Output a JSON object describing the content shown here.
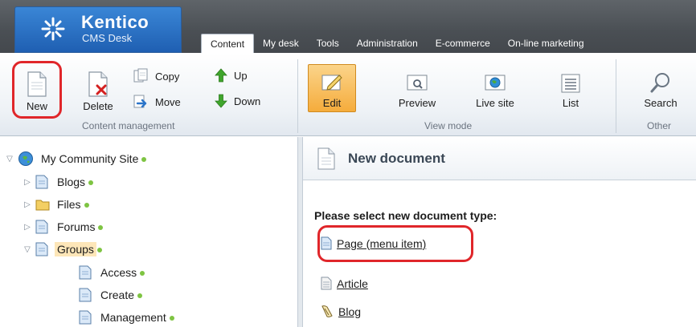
{
  "header": {
    "brand": "Kentico",
    "product": "CMS Desk",
    "tabs": [
      "Content",
      "My desk",
      "Tools",
      "Administration",
      "E-commerce",
      "On-line marketing"
    ],
    "active_tab": "Content"
  },
  "toolbar": {
    "new_label": "New",
    "delete_label": "Delete",
    "copy_label": "Copy",
    "move_label": "Move",
    "up_label": "Up",
    "down_label": "Down",
    "content_management_label": "Content management",
    "edit_label": "Edit",
    "preview_label": "Preview",
    "live_site_label": "Live site",
    "list_label": "List",
    "view_mode_label": "View mode",
    "search_label": "Search",
    "other_label": "Other"
  },
  "tree": {
    "root": "My Community Site",
    "items": [
      {
        "label": "Blogs"
      },
      {
        "label": "Files"
      },
      {
        "label": "Forums"
      },
      {
        "label": "Groups"
      },
      {
        "label": "Access"
      },
      {
        "label": "Create"
      },
      {
        "label": "Management"
      }
    ]
  },
  "main": {
    "title": "New document",
    "prompt": "Please select new document type:",
    "doc_types": [
      "Page (menu item)",
      "Article",
      "Blog"
    ]
  },
  "colors": {
    "highlight": "#e0262a",
    "active_button": "#f5ac3c",
    "status_dot": "#7ec442",
    "selected_node": "#fde6b8"
  }
}
